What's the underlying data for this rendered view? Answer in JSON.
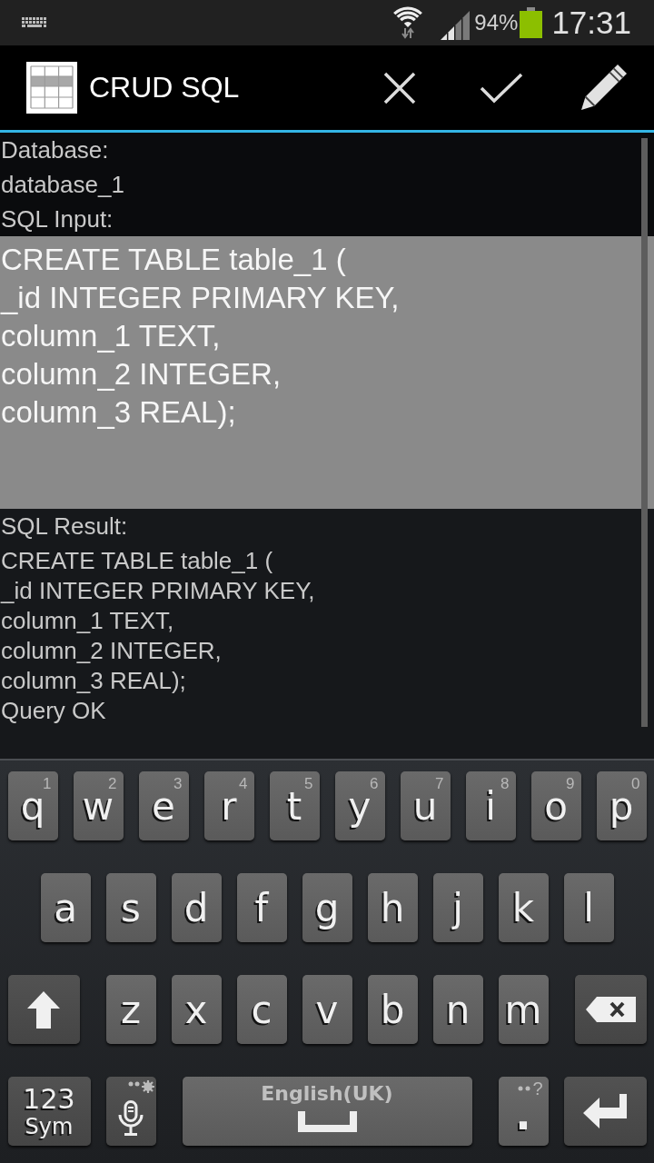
{
  "status_bar": {
    "battery": "94%",
    "time": "17:31"
  },
  "action_bar": {
    "title": "CRUD SQL"
  },
  "form": {
    "database_label": "Database:",
    "database": "database_1",
    "input_label": "SQL Input:",
    "sql_input": {
      "value": "CREATE TABLE table_1 (\n_id INTEGER PRIMARY KEY,\ncolumn_1 TEXT,\ncolumn_2 INTEGER,\ncolumn_3 REAL);"
    },
    "result_label": "SQL Result:",
    "result": "CREATE TABLE table_1 (\n_id INTEGER PRIMARY KEY,\ncolumn_1 TEXT,\ncolumn_2 INTEGER,\ncolumn_3 REAL);\nQuery OK"
  },
  "keyboard": {
    "top_letters": [
      {
        "kind": "letter",
        "label": "q",
        "hint": "1"
      },
      {
        "kind": "letter",
        "label": "w",
        "hint": "2"
      },
      {
        "kind": "letter",
        "label": "e",
        "hint": "3"
      },
      {
        "kind": "letter",
        "label": "r",
        "hint": "4"
      },
      {
        "kind": "letter",
        "label": "t",
        "hint": "5"
      },
      {
        "kind": "letter",
        "label": "y",
        "hint": "6"
      },
      {
        "kind": "letter",
        "label": "u",
        "hint": "7"
      },
      {
        "kind": "letter",
        "label": "i",
        "hint": "8"
      },
      {
        "kind": "letter",
        "label": "o",
        "hint": "9"
      },
      {
        "kind": "letter",
        "label": "p",
        "hint": "0"
      }
    ],
    "home_letters": [
      {
        "kind": "letter",
        "label": "a"
      },
      {
        "kind": "letter",
        "label": "s"
      },
      {
        "kind": "letter",
        "label": "d"
      },
      {
        "kind": "letter",
        "label": "f"
      },
      {
        "kind": "letter",
        "label": "g"
      },
      {
        "kind": "letter",
        "label": "h"
      },
      {
        "kind": "letter",
        "label": "j"
      },
      {
        "kind": "letter",
        "label": "k"
      },
      {
        "kind": "letter",
        "label": "l"
      }
    ],
    "lower_letters": [
      {
        "kind": "shift"
      },
      {
        "kind": "letter",
        "label": "z"
      },
      {
        "kind": "letter",
        "label": "x"
      },
      {
        "kind": "letter",
        "label": "c"
      },
      {
        "kind": "letter",
        "label": "v"
      },
      {
        "kind": "letter",
        "label": "b"
      },
      {
        "kind": "letter",
        "label": "n"
      },
      {
        "kind": "letter",
        "label": "m"
      },
      {
        "kind": "backspace"
      }
    ],
    "function_keys": [
      {
        "kind": "symbols",
        "label": "123",
        "sublabel": "Sym"
      },
      {
        "kind": "voice"
      },
      {
        "kind": "space",
        "label": "English(UK)"
      },
      {
        "kind": "period",
        "label": ".",
        "hint": "?"
      },
      {
        "kind": "enter"
      }
    ]
  }
}
